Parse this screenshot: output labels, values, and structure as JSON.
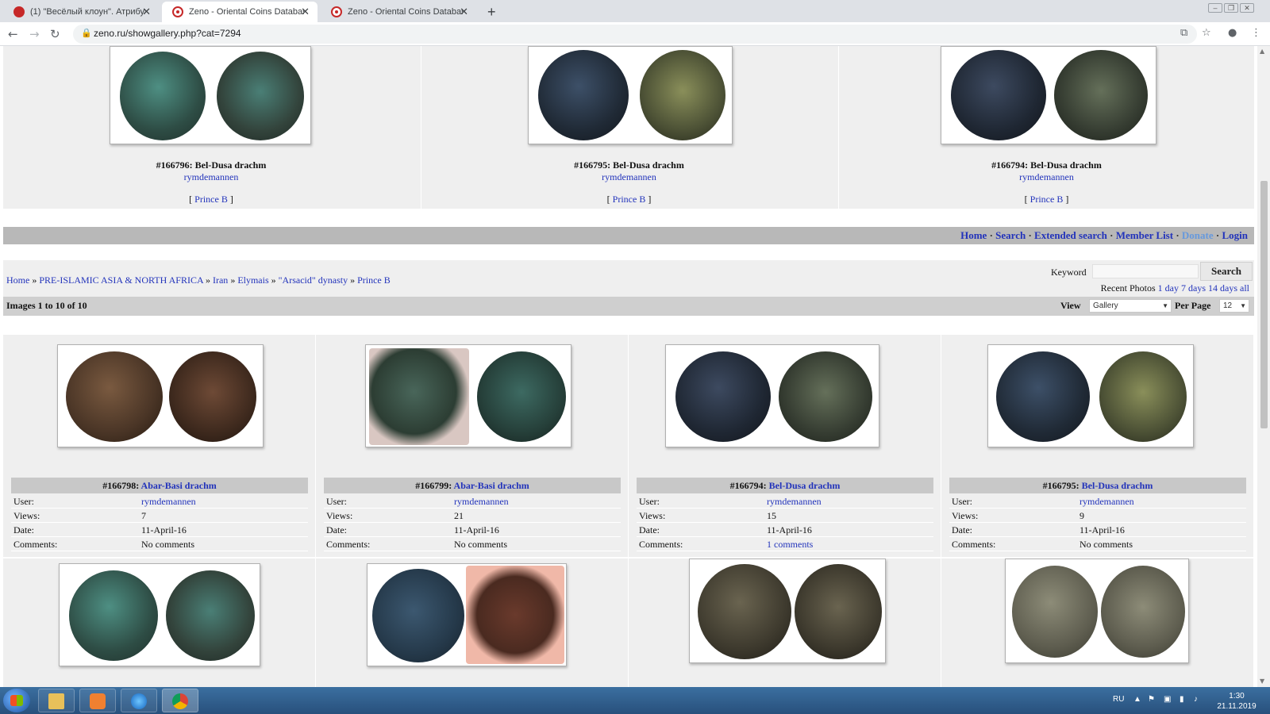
{
  "browser": {
    "tabs": [
      {
        "title": "(1) \"Весёлый клоун\". Атрибуция"
      },
      {
        "title": "Zeno - Oriental Coins Database -"
      },
      {
        "title": "Zeno - Oriental Coins Database -"
      }
    ],
    "tab_close": "✕",
    "new_tab": "+",
    "url": "zeno.ru/showgallery.php?cat=7294"
  },
  "top_gallery": [
    {
      "title": "#166796: Bel-Dusa drachm",
      "user": "rymdemannen",
      "category": "Prince B"
    },
    {
      "title": "#166795: Bel-Dusa drachm",
      "user": "rymdemannen",
      "category": "Prince B"
    },
    {
      "title": "#166794: Bel-Dusa drachm",
      "user": "rymdemannen",
      "category": "Prince B"
    }
  ],
  "nav": {
    "home": "Home",
    "search": "Search",
    "extended_search": "Extended search",
    "member_list": "Member List",
    "donate": "Donate",
    "login": "Login",
    "sep": "·"
  },
  "breadcrumb": {
    "items": [
      "Home",
      "PRE-ISLAMIC ASIA & NORTH AFRICA",
      "Iran",
      "Elymais",
      "\"Arsacid\" dynasty",
      "Prince B"
    ],
    "sep": "»"
  },
  "search": {
    "keyword_label": "Keyword",
    "keyword_value": "",
    "button": "Search",
    "recent_label": "Recent Photos",
    "recent_links": [
      "1 day",
      "7 days",
      "14 days",
      "all"
    ]
  },
  "gallery": {
    "count_text": "Images 1 to 10 of 10",
    "view_label": "View",
    "view_value": "Gallery",
    "per_page_label": "Per Page",
    "per_page_value": "12",
    "labels": {
      "user": "User:",
      "views": "Views:",
      "date": "Date:",
      "comments": "Comments:"
    },
    "items": [
      {
        "id": "#166798:",
        "name": "Abar-Basi drachm",
        "user": "rymdemannen",
        "views": "7",
        "date": "11-April-16",
        "comments": "No comments"
      },
      {
        "id": "#166799:",
        "name": "Abar-Basi drachm",
        "user": "rymdemannen",
        "views": "21",
        "date": "11-April-16",
        "comments": "No comments"
      },
      {
        "id": "#166794:",
        "name": "Bel-Dusa drachm",
        "user": "rymdemannen",
        "views": "15",
        "date": "11-April-16",
        "comments": "1 comments"
      },
      {
        "id": "#166795:",
        "name": "Bel-Dusa drachm",
        "user": "rymdemannen",
        "views": "9",
        "date": "11-April-16",
        "comments": "No comments"
      }
    ]
  },
  "taskbar": {
    "lang": "RU",
    "time": "1:30",
    "date": "21.11.2019"
  },
  "colors": {
    "link": "#2233bb",
    "donate": "#6699dd",
    "nav_bar": "#b8b8b8",
    "panel": "#efefef",
    "info_header": "#c8c8c8"
  }
}
